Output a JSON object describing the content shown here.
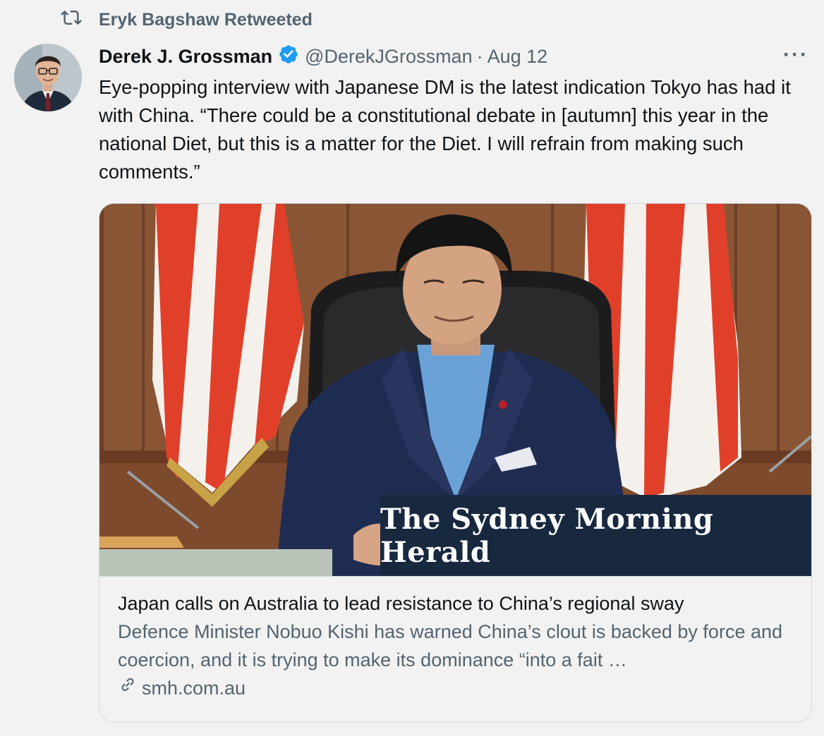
{
  "retweet": {
    "label": "Eryk Bagshaw Retweeted",
    "icon": "retweet-icon"
  },
  "tweet": {
    "author": {
      "display_name": "Derek J. Grossman",
      "handle": "@DerekJGrossman",
      "verified_icon": "verified-badge-icon"
    },
    "separator": "·",
    "date": "Aug 12",
    "more_icon": "···",
    "text": "Eye-popping interview with Japanese DM is the latest indication Tokyo has had it with China. “There could be a constitutional debate in [autumn] this year in the national Diet, but this is a matter for the Diet. I will refrain from making such comments.”"
  },
  "card": {
    "image_logo_text": "The Sydney Morning Herald",
    "title": "Japan calls on Australia to lead resistance to China’s regional sway",
    "description": "Defence Minister Nobuo Kishi has warned China’s clout is backed by force and coercion, and it is trying to make its dominance “into a fait …",
    "domain": "smh.com.au",
    "link_icon": "link-icon"
  },
  "colors": {
    "background": "#f2f2f2",
    "text_primary": "#0f1419",
    "text_secondary": "#536471",
    "verified_blue": "#1d9bf0",
    "card_border": "#cfd9de",
    "smh_band": "#17283f"
  }
}
